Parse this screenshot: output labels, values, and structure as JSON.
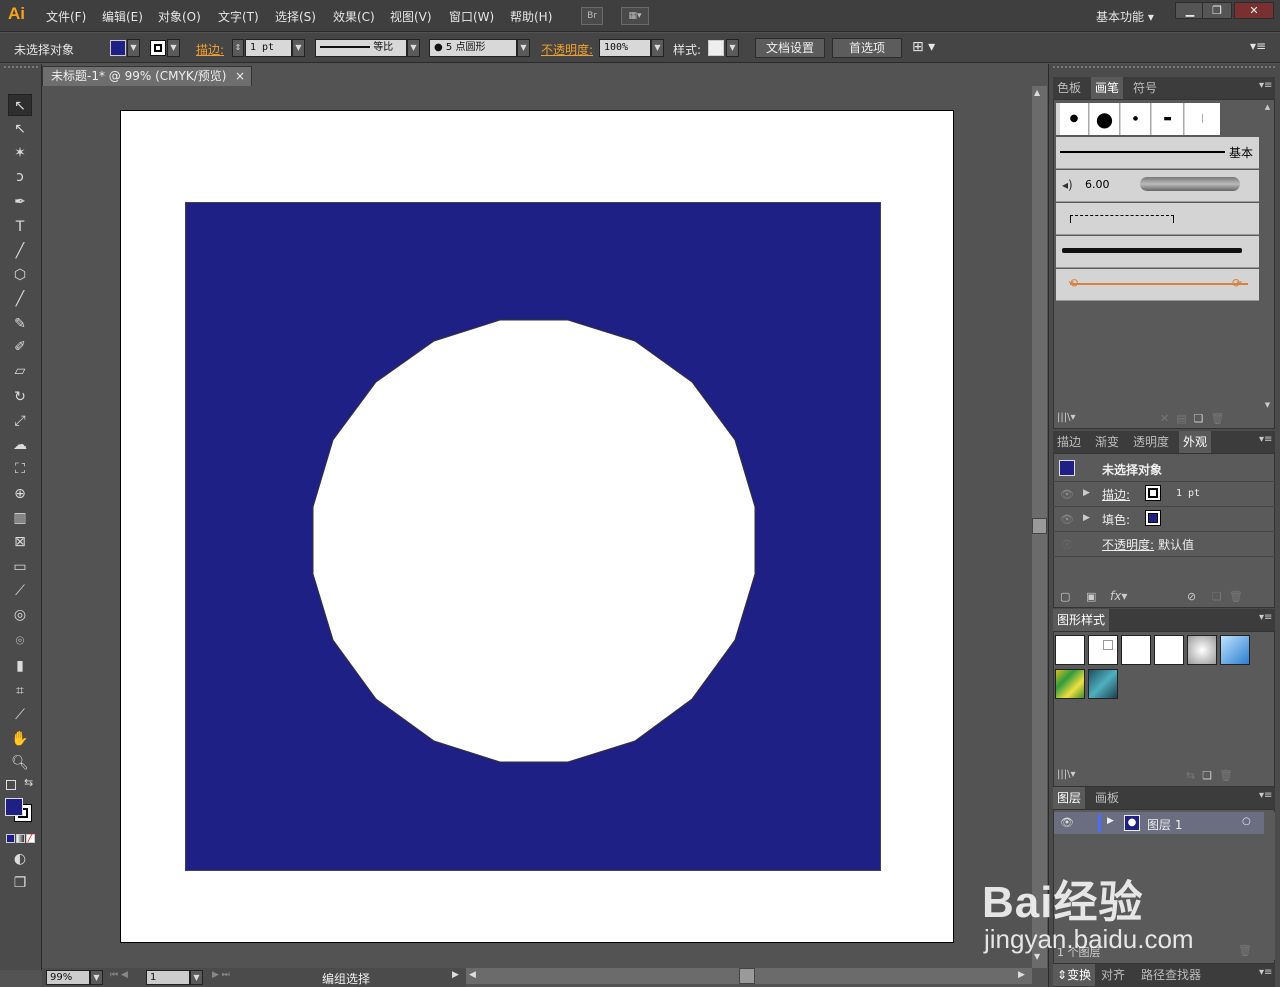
{
  "app": {
    "logo": "Ai"
  },
  "menu": {
    "items": [
      "文件(F)",
      "编辑(E)",
      "对象(O)",
      "文字(T)",
      "选择(S)",
      "效果(C)",
      "视图(V)",
      "窗口(W)",
      "帮助(H)"
    ],
    "bridge_label": "Br",
    "workspace": "基本功能"
  },
  "control": {
    "no_selection": "未选择对象",
    "stroke_label": "描边:",
    "stroke_weight": "1 pt",
    "stroke_profile": "等比",
    "brush": "5 点圆形",
    "opacity_label": "不透明度:",
    "opacity_value": "100%",
    "style_label": "样式:",
    "doc_setup": "文档设置",
    "preferences": "首选项"
  },
  "document": {
    "tab_title": "未标题-1* @ 99% (CMYK/预览)",
    "close": "×"
  },
  "colors": {
    "fill": "#1f2085",
    "orange": "#f0a030",
    "panel_bg": "#5a5a5a"
  },
  "brushes_panel": {
    "tabs": [
      "色板",
      "画笔",
      "符号"
    ],
    "basic_label": "基本",
    "size_value": "6.00"
  },
  "appearance_panel": {
    "tabs": [
      "描边",
      "渐变",
      "透明度",
      "外观"
    ],
    "title": "未选择对象",
    "stroke_label": "描边:",
    "stroke_value": "1 pt",
    "fill_label": "填色:",
    "opacity_label": "不透明度:",
    "opacity_value": "默认值",
    "fx": "fx"
  },
  "graphic_styles": {
    "tab": "图形样式"
  },
  "layers_panel": {
    "tabs": [
      "图层",
      "画板"
    ],
    "layer_name": "图层 1",
    "layer_count": "1 个图层"
  },
  "bottom_tabs": [
    "变换",
    "对齐",
    "路径查找器"
  ],
  "status": {
    "zoom": "99%",
    "artboard_number": "1",
    "mode": "编组选择"
  },
  "watermark": {
    "brand": "Bai经验",
    "url": "jingyan.baidu.com"
  }
}
